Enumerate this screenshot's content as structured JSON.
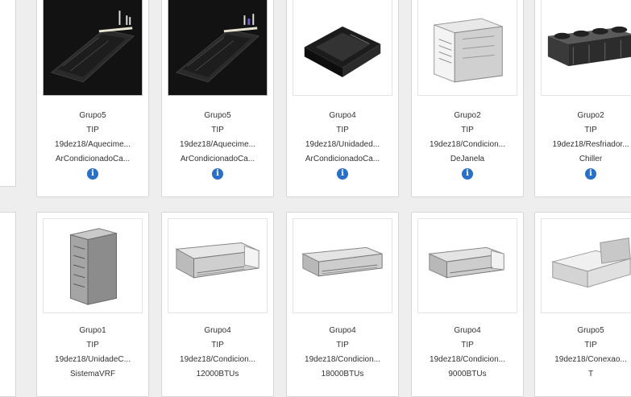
{
  "cards": [
    {
      "group": "Grupo5",
      "type": "TIP",
      "path": "19dez18/Aquecime...",
      "name": "ArCondicionadoCa...",
      "icon": "info-icon"
    },
    {
      "group": "Grupo5",
      "type": "TIP",
      "path": "19dez18/Aquecime...",
      "name": "ArCondicionadoCa...",
      "icon": "info-icon"
    },
    {
      "group": "Grupo4",
      "type": "TIP",
      "path": "19dez18/Unidaded...",
      "name": "ArCondicionadoCa...",
      "icon": "info-icon"
    },
    {
      "group": "Grupo2",
      "type": "TIP",
      "path": "19dez18/Condicion...",
      "name": "DeJanela",
      "icon": "info-icon"
    },
    {
      "group": "Grupo2",
      "type": "TIP",
      "path": "19dez18/Resfriador...",
      "name": "Chiller",
      "icon": "info-icon"
    },
    {
      "group": "Grupo1",
      "type": "TIP",
      "path": "19dez18/UnidadeC...",
      "name": "SistemaVRF"
    },
    {
      "group": "Grupo4",
      "type": "TIP",
      "path": "19dez18/Condicion...",
      "name": "12000BTUs"
    },
    {
      "group": "Grupo4",
      "type": "TIP",
      "path": "19dez18/Condicion...",
      "name": "18000BTUs"
    },
    {
      "group": "Grupo4",
      "type": "TIP",
      "path": "19dez18/Condicion...",
      "name": "9000BTUs"
    },
    {
      "group": "Grupo5",
      "type": "TIP",
      "path": "19dez18/Conexao...",
      "name": "T"
    }
  ],
  "colors": {
    "info": "#2a6fc7"
  }
}
